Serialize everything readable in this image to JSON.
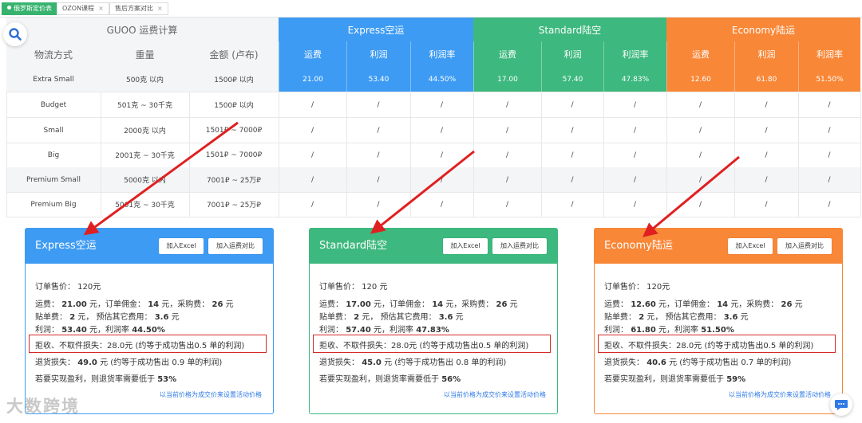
{
  "tabs": [
    {
      "label": "俄罗斯定价表",
      "active": true
    },
    {
      "label": "OZON课程",
      "active": false
    },
    {
      "label": "售后方案对比",
      "active": false
    }
  ],
  "table": {
    "calc_title": "GUOO 运费计算",
    "col_headers": [
      "物流方式",
      "重量",
      "金额 (卢布)"
    ],
    "bands": [
      {
        "name": "Express空运",
        "color": "#3d9bf3",
        "subs": [
          "运费",
          "利润",
          "利润率"
        ]
      },
      {
        "name": "Standard陆空",
        "color": "#3db87e",
        "subs": [
          "运费",
          "利润",
          "利润率"
        ]
      },
      {
        "name": "Economy陆运",
        "color": "#f88737",
        "subs": [
          "运费",
          "利润",
          "利润率"
        ]
      }
    ],
    "rows": [
      {
        "method": "Extra Small",
        "weight": "500克 以内",
        "amount": "1500₽ 以内",
        "values": [
          "21.00",
          "53.40",
          "44.50%",
          "17.00",
          "57.40",
          "47.83%",
          "12.60",
          "61.80",
          "51.50%"
        ]
      },
      {
        "method": "Budget",
        "weight": "501克 ~ 30千克",
        "amount": "1500₽ 以内",
        "values": [
          "/",
          "/",
          "/",
          "/",
          "/",
          "/",
          "/",
          "/",
          "/"
        ]
      },
      {
        "method": "Small",
        "weight": "2000克 以内",
        "amount": "1501₽ ~ 7000₽",
        "values": [
          "/",
          "/",
          "/",
          "/",
          "/",
          "/",
          "/",
          "/",
          "/"
        ]
      },
      {
        "method": "Big",
        "weight": "2001克 ~ 30千克",
        "amount": "1501₽ ~ 7000₽",
        "values": [
          "/",
          "/",
          "/",
          "/",
          "/",
          "/",
          "/",
          "/",
          "/"
        ]
      },
      {
        "method": "Premium Small",
        "weight": "5000克 以内",
        "amount": "7001₽ ~ 25万₽",
        "values": [
          "/",
          "/",
          "/",
          "/",
          "/",
          "/",
          "/",
          "/",
          "/"
        ]
      },
      {
        "method": "Premium Big",
        "weight": "5001克 ~ 30千克",
        "amount": "7001₽ ~ 25万₽",
        "values": [
          "/",
          "/",
          "/",
          "/",
          "/",
          "/",
          "/",
          "/",
          "/"
        ]
      }
    ]
  },
  "cards": [
    {
      "title": "Express空运",
      "color": "#3d9bf3",
      "btn_excel": "加入Excel",
      "btn_compare": "加入运费对比",
      "price_line": "订单售价：  120元",
      "shipping_label": "运费：",
      "shipping": "21.00",
      "shipping_unit": "元，订单佣金：",
      "commission": "14",
      "commission_unit": "元，采购费：",
      "purchase": "26",
      "purchase_unit": "元",
      "label_label": "贴单费：",
      "label_fee": "2",
      "label_unit": "元，   预估其它费用：",
      "other": "3.6",
      "other_unit": "元",
      "profit_label": "利润：",
      "profit": "53.40",
      "profit_unit": "元，利润率",
      "rate": "44.50%",
      "reject_text": "拒收、不取件损失：28.0元   (约等于成功售出0.5 单的利润)",
      "return_label": "退货损失：",
      "return_loss": "49.0",
      "return_tail": "元   (约等于成功售出 0.9 单的利润)",
      "need_text": "若要实现盈利，则退货率需要低于",
      "need_rate": "53%",
      "link": "以当前价格为成交价来设置活动价格"
    },
    {
      "title": "Standard陆空",
      "color": "#3db87e",
      "btn_excel": "加入Excel",
      "btn_compare": "加入运费对比",
      "price_line": "订单售价：  120 元",
      "shipping_label": "运费：",
      "shipping": "17.00",
      "shipping_unit": "元，订单佣金：",
      "commission": "14",
      "commission_unit": "元，采购费：",
      "purchase": "26",
      "purchase_unit": "元",
      "label_label": "贴单费：",
      "label_fee": "2",
      "label_unit": "元，   预估其它费用：",
      "other": "3.6",
      "other_unit": "元",
      "profit_label": "利润：",
      "profit": "57.40",
      "profit_unit": "元，利润率",
      "rate": "47.83%",
      "reject_text": "拒收、不取件损失：28.0元   (约等于成功售出0.5 单的利润)",
      "return_label": "退货损失：",
      "return_loss": "45.0",
      "return_tail": "元   (约等于成功售出 0.8 单的利润)",
      "need_text": "若要实现盈利，则退货率需要低于",
      "need_rate": "56%",
      "link": "以当前价格为成交价来设置活动价格"
    },
    {
      "title": "Economy陆运",
      "color": "#f88737",
      "btn_excel": "加入Excel",
      "btn_compare": "加入运费对比",
      "price_line": "订单售价：  120元",
      "shipping_label": "运费：",
      "shipping": "12.60",
      "shipping_unit": "元，订单佣金：",
      "commission": "14",
      "commission_unit": "元，采购费：",
      "purchase": "26",
      "purchase_unit": "元",
      "label_label": "贴单费：",
      "label_fee": "2",
      "label_unit": "元，   预估其它费用：",
      "other": "3.6",
      "other_unit": "元",
      "profit_label": "利润：",
      "profit": "61.80",
      "profit_unit": "元，利润率",
      "rate": "51.50%",
      "reject_text": "拒收、不取件损失：28.0元   (约等于成功售出0.5 单的利润)",
      "return_label": "退货损失：",
      "return_loss": "40.6",
      "return_tail": "元   (约等于成功售出 0.7 单的利润)",
      "need_text": "若要实现盈利，则退货率需要低于",
      "need_rate": "59%",
      "link": "以当前价格为成交价来设置活动价格"
    }
  ],
  "watermark": "大数跨境",
  "icons": [
    "search-icon",
    "chat-icon",
    "close-icon"
  ]
}
